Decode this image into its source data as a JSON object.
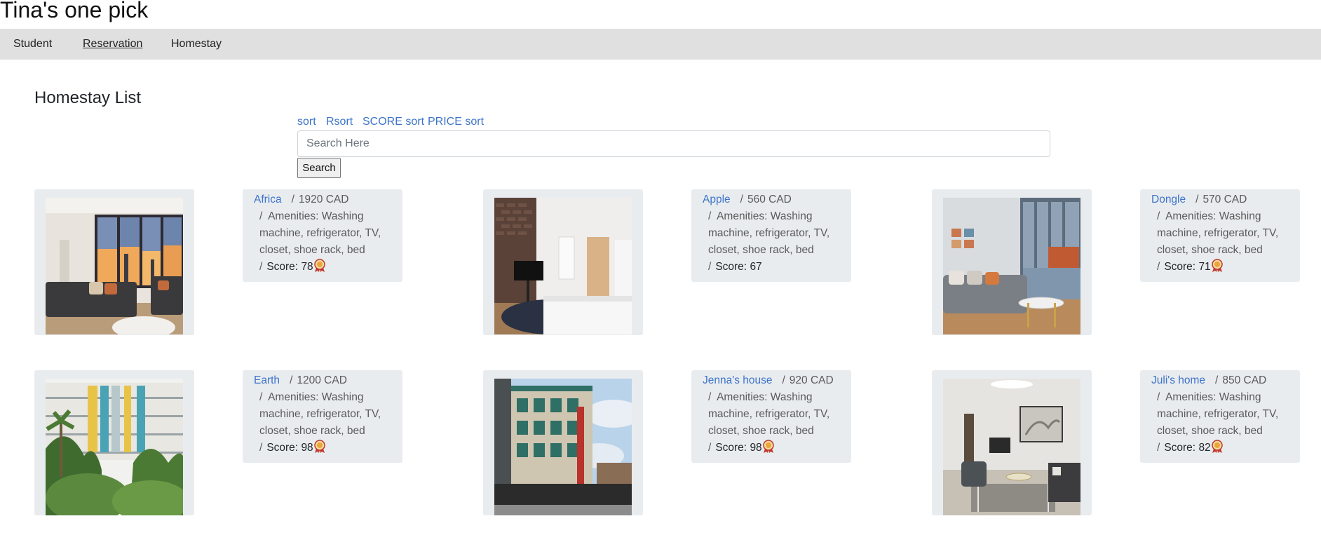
{
  "site": {
    "title": "Tina's one pick"
  },
  "nav": {
    "items": [
      "Student",
      "Reservation",
      "Homestay"
    ],
    "active": "Reservation"
  },
  "page": {
    "heading": "Homestay List"
  },
  "sort_links": [
    "sort",
    "Rsort",
    "SCORE sort",
    "PRICE sort"
  ],
  "search": {
    "placeholder": "Search Here",
    "value": "",
    "button_label": "Search"
  },
  "listing_labels": {
    "separator": "/",
    "amenities_prefix": "Amenities:",
    "score_prefix": "Score:"
  },
  "homestays": [
    {
      "name": "Africa",
      "price": "1920 CAD",
      "amenities": "Washing machine, refrigerator, TV, closet, shoe rack, bed",
      "score": "78",
      "has_badge": true,
      "photo": "living-room-sunset-view"
    },
    {
      "name": "Apple",
      "price": "560 CAD",
      "amenities": "Washing machine, refrigerator, TV, closet, shoe rack, bed",
      "score": "67",
      "has_badge": false,
      "photo": "bedroom-brick-wall-tv"
    },
    {
      "name": "Dongle",
      "price": "570 CAD",
      "amenities": "Washing machine, refrigerator, TV, closet, shoe rack, bed",
      "score": "71",
      "has_badge": true,
      "photo": "living-room-balcony"
    },
    {
      "name": "Earth",
      "price": "1200 CAD",
      "amenities": "Washing machine, refrigerator, TV, closet, shoe rack, bed",
      "score": "98",
      "has_badge": true,
      "photo": "apartment-building-palms"
    },
    {
      "name": "Jenna's house",
      "price": "920 CAD",
      "amenities": "Washing machine, refrigerator, TV, closet, shoe rack, bed",
      "score": "98",
      "has_badge": true,
      "photo": "heritage-building-street"
    },
    {
      "name": "Juli's home",
      "price": "850 CAD",
      "amenities": "Washing machine, refrigerator, TV, closet, shoe rack, bed",
      "score": "82",
      "has_badge": true,
      "photo": "living-room-rug"
    }
  ],
  "colors": {
    "link": "#3d74c9",
    "card_bg": "#e9ecef",
    "navbar_bg": "#e0e0e0",
    "badge": "#c0392b"
  }
}
